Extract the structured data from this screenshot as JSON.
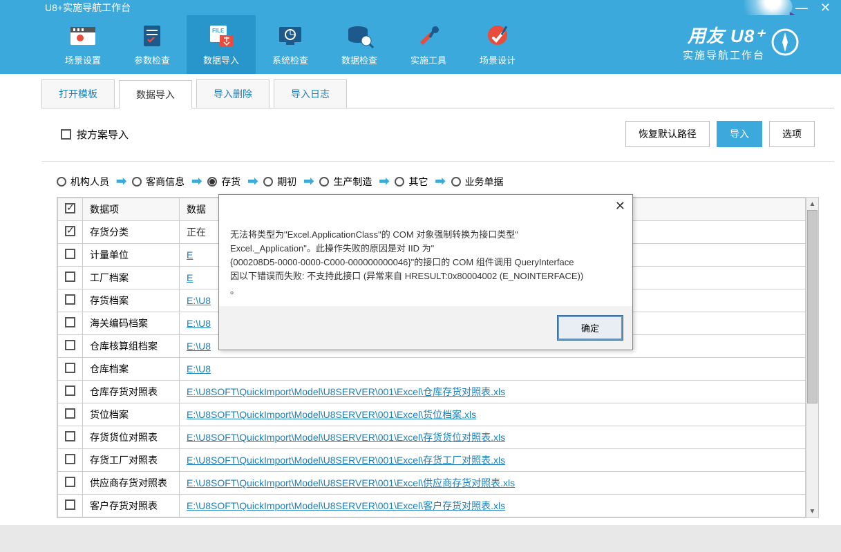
{
  "titlebar": {
    "title": "U8+实施导航工作台"
  },
  "brand": {
    "main": "用友 U8⁺",
    "sub": "实施导航工作台"
  },
  "toolbar": [
    {
      "label": "场景设置",
      "name": "scene-settings"
    },
    {
      "label": "参数检查",
      "name": "parameter-check"
    },
    {
      "label": "数据导入",
      "name": "data-import",
      "active": true
    },
    {
      "label": "系统检查",
      "name": "system-check"
    },
    {
      "label": "数据检查",
      "name": "data-check"
    },
    {
      "label": "实施工具",
      "name": "impl-tools"
    },
    {
      "label": "场景设计",
      "name": "scene-design"
    }
  ],
  "tabs": [
    {
      "label": "打开模板",
      "name": "open-template"
    },
    {
      "label": "数据导入",
      "name": "data-import-tab",
      "active": true
    },
    {
      "label": "导入删除",
      "name": "import-delete"
    },
    {
      "label": "导入日志",
      "name": "import-log"
    }
  ],
  "actionbar": {
    "scheme_checkbox_label": "按方案导入",
    "buttons": {
      "restore": "恢复默认路径",
      "import": "导入",
      "options": "选项"
    }
  },
  "steps": [
    {
      "label": "机构人员",
      "selected": false
    },
    {
      "label": "客商信息",
      "selected": false
    },
    {
      "label": "存货",
      "selected": true
    },
    {
      "label": "期初",
      "selected": false
    },
    {
      "label": "生产制造",
      "selected": false
    },
    {
      "label": "其它",
      "selected": false
    },
    {
      "label": "业务单据",
      "selected": false
    }
  ],
  "table": {
    "headers": {
      "item": "数据项",
      "path": "数据"
    },
    "rows": [
      {
        "checked": true,
        "item": "存货分类",
        "path": "正在",
        "truncated": true
      },
      {
        "checked": false,
        "item": "计量单位",
        "path": "E",
        "truncated": true,
        "link": true
      },
      {
        "checked": false,
        "item": "工厂档案",
        "path": "E",
        "truncated": true,
        "link": true
      },
      {
        "checked": false,
        "item": "存货档案",
        "path": "E:\\U8",
        "truncated": true,
        "link": true
      },
      {
        "checked": false,
        "item": "海关编码档案",
        "path": "E:\\U8",
        "truncated": true,
        "link": true
      },
      {
        "checked": false,
        "item": "仓库核算组档案",
        "path": "E:\\U8",
        "truncated": true,
        "link": true
      },
      {
        "checked": false,
        "item": "仓库档案",
        "path": "E:\\U8",
        "truncated": true,
        "link": true
      },
      {
        "checked": false,
        "item": "仓库存货对照表",
        "path": "E:\\U8SOFT\\QuickImport\\Model\\U8SERVER\\001\\Excel\\仓库存货对照表.xls",
        "link": true
      },
      {
        "checked": false,
        "item": "货位档案",
        "path": "E:\\U8SOFT\\QuickImport\\Model\\U8SERVER\\001\\Excel\\货位档案.xls",
        "link": true
      },
      {
        "checked": false,
        "item": "存货货位对照表",
        "path": "E:\\U8SOFT\\QuickImport\\Model\\U8SERVER\\001\\Excel\\存货货位对照表.xls",
        "link": true
      },
      {
        "checked": false,
        "item": "存货工厂对照表",
        "path": "E:\\U8SOFT\\QuickImport\\Model\\U8SERVER\\001\\Excel\\存货工厂对照表.xls",
        "link": true
      },
      {
        "checked": false,
        "item": "供应商存货对照表",
        "path": "E:\\U8SOFT\\QuickImport\\Model\\U8SERVER\\001\\Excel\\供应商存货对照表.xls",
        "link": true
      },
      {
        "checked": false,
        "item": "客户存货对照表",
        "path": "E:\\U8SOFT\\QuickImport\\Model\\U8SERVER\\001\\Excel\\客户存货对照表.xls",
        "link": true
      }
    ]
  },
  "dialog": {
    "message_l1": "无法将类型为\"Excel.ApplicationClass\"的 COM 对象强制转换为接口类型\"",
    "message_l2": "Excel._Application\"。此操作失败的原因是对 IID 为\"",
    "message_l3": "{000208D5-0000-0000-C000-000000000046}\"的接口的 COM 组件调用 QueryInterface",
    "message_l4": "因以下错误而失败: 不支持此接口 (异常来自 HRESULT:0x80004002 (E_NOINTERFACE))",
    "message_l5": "。",
    "ok": "确定"
  }
}
